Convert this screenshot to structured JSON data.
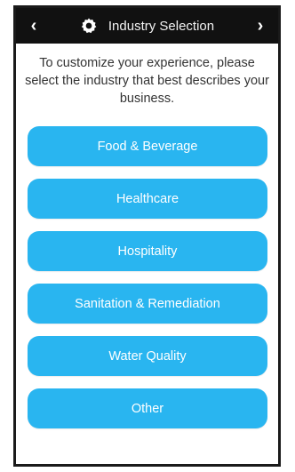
{
  "header": {
    "title": "Industry Selection",
    "back_icon": "chevron-left-icon",
    "forward_icon": "chevron-right-icon",
    "app_icon": "gear-icon"
  },
  "intro": {
    "text": "To customize your experience, please select the industry that best describes your business."
  },
  "options": [
    {
      "label": "Food & Beverage"
    },
    {
      "label": "Healthcare"
    },
    {
      "label": "Hospitality"
    },
    {
      "label": "Sanitation & Remediation"
    },
    {
      "label": "Water Quality"
    },
    {
      "label": "Other"
    }
  ],
  "colors": {
    "header_bg": "#111111",
    "button_bg": "#29b5f0",
    "button_text": "#ffffff"
  }
}
